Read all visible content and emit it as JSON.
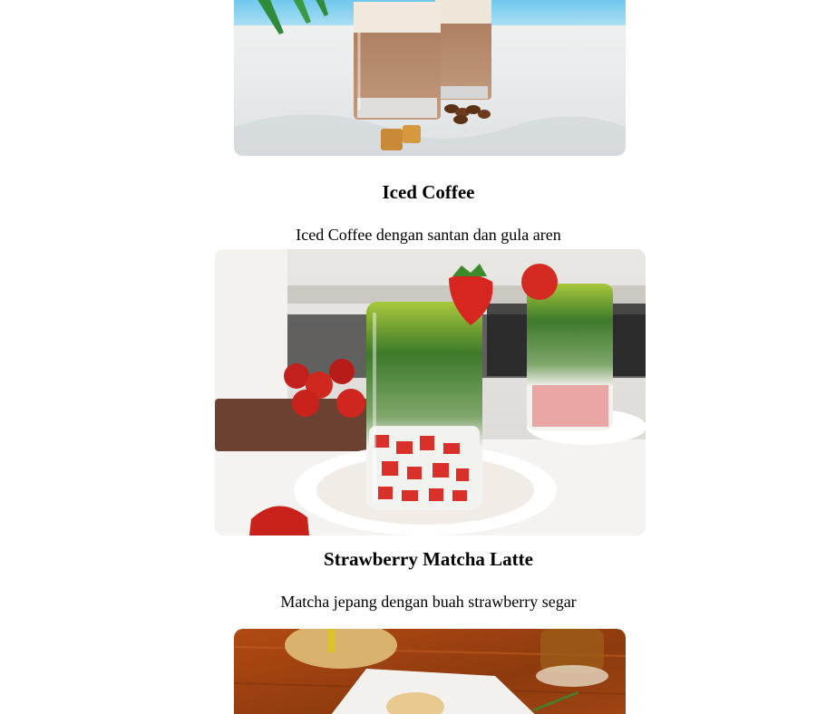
{
  "menu": {
    "items": [
      {
        "name": "Iced Coffee",
        "description": "Iced Coffee dengan santan dan gula aren",
        "image": "iced-coffee-photo"
      },
      {
        "name": "Strawberry Matcha Latte",
        "description": "Matcha jepang dengan buah strawberry segar",
        "image": "strawberry-matcha-latte-photo"
      },
      {
        "image": "pastry-and-tea-photo"
      }
    ]
  }
}
